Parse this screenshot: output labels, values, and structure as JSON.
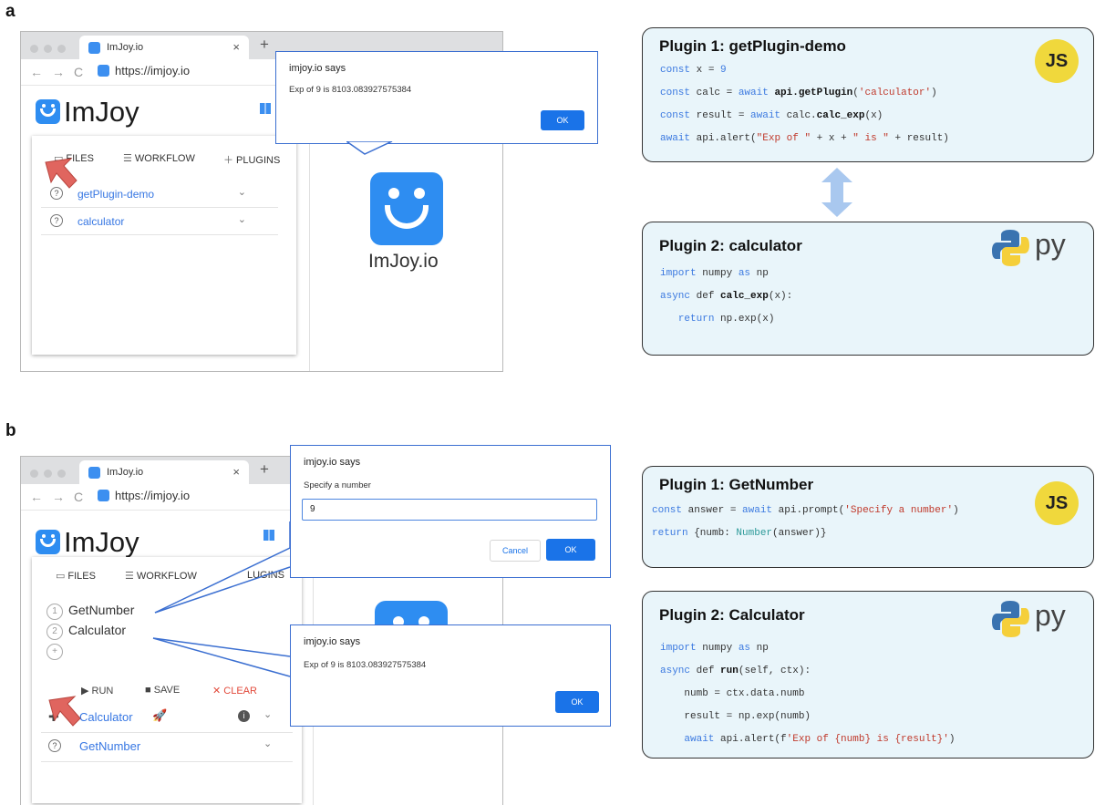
{
  "panels": {
    "a": "a",
    "b": "b"
  },
  "browser": {
    "tab_title": "ImJoy.io",
    "tab_close": "×",
    "new_tab": "+",
    "url": "https://imjoy.io",
    "logo_text": "ImJoy",
    "app_label": "ImJoy.io"
  },
  "menu": {
    "files": "FILES",
    "workflow": "WORKFLOW",
    "plugins": "PLUGINS",
    "plugins_clipped": "LUGINS"
  },
  "panel_a": {
    "plugins": [
      {
        "name": "getPlugin-demo"
      },
      {
        "name": "calculator"
      }
    ],
    "dialog": {
      "title": "imjoy.io says",
      "message": "Exp of 9 is 8103.083927575384",
      "ok": "OK"
    },
    "code1": {
      "title": "Plugin 1: getPlugin-demo",
      "badge": "JS"
    },
    "code2": {
      "title": "Plugin 2: calculator",
      "badge": "py"
    }
  },
  "panel_b": {
    "prompt_dialog": {
      "title": "imjoy.io says",
      "message": "Specify a number",
      "input_value": "9",
      "cancel": "Cancel",
      "ok": "OK"
    },
    "alert_dialog": {
      "title": "imjoy.io says",
      "message": "Exp of 9 is 8103.083927575384",
      "ok": "OK"
    },
    "workflow": [
      {
        "num": "1",
        "name": "GetNumber"
      },
      {
        "num": "2",
        "name": "Calculator"
      },
      {
        "num": "+",
        "name": ""
      }
    ],
    "actions": {
      "run": "RUN",
      "save": "SAVE",
      "clear": "CLEAR"
    },
    "plugins": [
      {
        "name": "Calculator"
      },
      {
        "name": "GetNumber"
      }
    ],
    "code1": {
      "title": "Plugin 1: GetNumber",
      "badge": "JS"
    },
    "code2": {
      "title": "Plugin 2: Calculator",
      "badge": "py"
    }
  },
  "colors": {
    "accent": "#2e8df1",
    "dialog_border": "#3b6fd1",
    "arrow": "#e0655f",
    "code_bg": "#e9f5fa",
    "js_yellow": "#f0d83c"
  }
}
